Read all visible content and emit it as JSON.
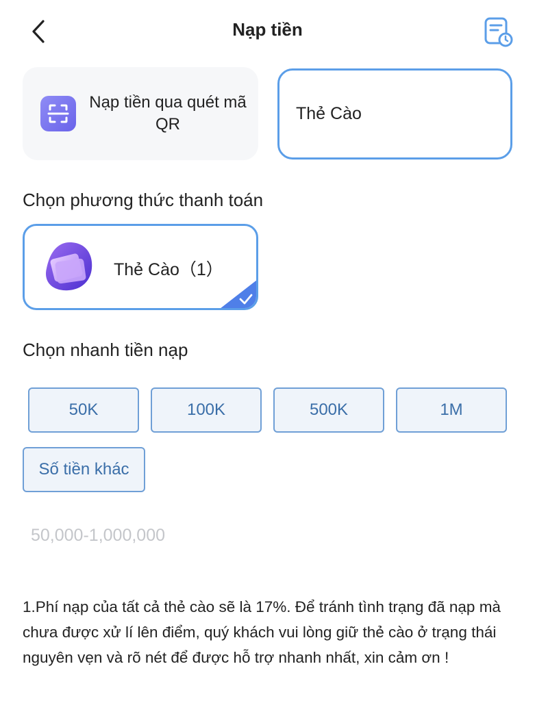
{
  "header": {
    "title": "Nạp tiền",
    "back_icon": "chevron-left-icon",
    "history_icon": "history-record-icon"
  },
  "options": {
    "qr_label": "Nạp tiền qua quét mã QR",
    "qr_icon": "qr-scan-icon",
    "card_label": "Thẻ Cào"
  },
  "payment": {
    "section_label": "Chọn phương thức thanh toán",
    "method_label": "Thẻ Cào（1）",
    "method_icon": "wallet-card-icon",
    "selected": true
  },
  "amounts": {
    "section_label": "Chọn nhanh tiền nạp",
    "presets": [
      "50K",
      "100K",
      "500K",
      "1M"
    ],
    "other_label": "Số tiền khác",
    "input_value": "",
    "input_placeholder": "50,000-1,000,000"
  },
  "notice": "1.Phí nạp của tất cả thẻ cào sẽ là 17%. Để tránh tình trạng đã nạp mà chưa được xử lí lên điểm, quý khách vui lòng giữ thẻ cào ở trạng thái nguyên vẹn và rõ nét  để được hỗ trợ nhanh nhất, xin cảm ơn !",
  "colors": {
    "accent": "#5b9ee8",
    "chip_border": "#6f9fd6",
    "chip_bg": "#eff4fa",
    "chip_text": "#3a6ea8",
    "icon_purple": "#6a63ea"
  }
}
